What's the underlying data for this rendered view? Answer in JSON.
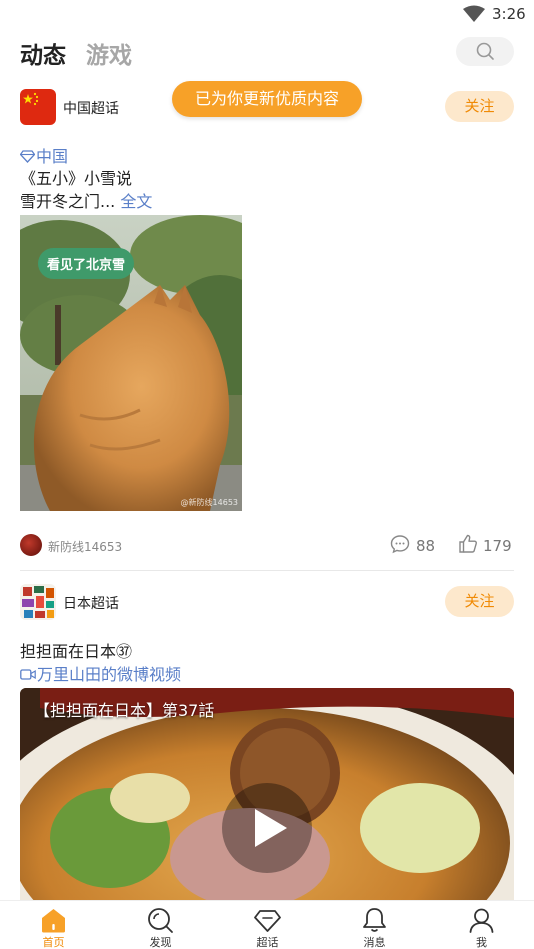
{
  "status_bar": {
    "time": "3:26"
  },
  "top_nav": {
    "tabs": [
      {
        "label": "动态",
        "active": true
      },
      {
        "label": "游戏",
        "active": false
      }
    ]
  },
  "toast": {
    "text": "已为你更新优质内容"
  },
  "posts": [
    {
      "source_name": "中国超话",
      "follow_label": "关注",
      "topic": "中国",
      "line1": "《五小》小雪说",
      "line2": "雪开冬之门...",
      "more_label": "全文",
      "image_caption": "看见了北京雪",
      "image_watermark": "@新防线14653",
      "author": "新防线14653",
      "comments": "88",
      "likes": "179"
    },
    {
      "source_name": "日本超话",
      "follow_label": "关注",
      "text": "担担面在日本㊲",
      "video_link": "万里山田的微博视频",
      "video_title": "【担担面在日本】第37話"
    }
  ],
  "bottom_nav": [
    {
      "label": "首页",
      "icon": "home-icon",
      "active": true
    },
    {
      "label": "发现",
      "icon": "discover-icon",
      "active": false
    },
    {
      "label": "超话",
      "icon": "diamond-icon",
      "active": false
    },
    {
      "label": "消息",
      "icon": "bell-icon",
      "active": false
    },
    {
      "label": "我",
      "icon": "profile-icon",
      "active": false
    }
  ],
  "colors": {
    "accent": "#f7a128",
    "follow_bg": "#fde8cc",
    "follow_text": "#f08a05",
    "link": "#5a7fc8"
  }
}
